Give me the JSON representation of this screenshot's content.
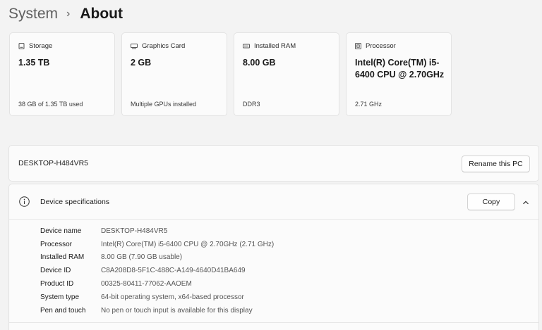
{
  "breadcrumb": {
    "parent": "System",
    "separator": "›",
    "current": "About"
  },
  "cards": [
    {
      "icon": "storage-icon",
      "label": "Storage",
      "value": "1.35 TB",
      "sub": "38 GB of 1.35 TB used"
    },
    {
      "icon": "graphics-card-icon",
      "label": "Graphics Card",
      "value": "2 GB",
      "sub": "Multiple GPUs installed"
    },
    {
      "icon": "ram-icon",
      "label": "Installed RAM",
      "value": "8.00 GB",
      "sub": "DDR3"
    },
    {
      "icon": "processor-icon",
      "label": "Processor",
      "value": "Intel(R) Core(TM) i5-6400 CPU @ 2.70GHz",
      "sub": "2.71 GHz"
    }
  ],
  "pc": {
    "name": "DESKTOP-H484VR5",
    "rename_label": "Rename this PC"
  },
  "specs": {
    "title": "Device specifications",
    "copy_label": "Copy",
    "rows": [
      {
        "key": "Device name",
        "value": "DESKTOP-H484VR5"
      },
      {
        "key": "Processor",
        "value": "Intel(R) Core(TM) i5-6400 CPU @ 2.70GHz (2.71 GHz)"
      },
      {
        "key": "Installed RAM",
        "value": "8.00 GB (7.90 GB usable)"
      },
      {
        "key": "Device ID",
        "value": "C8A208D8-5F1C-488C-A149-4640D41BA649"
      },
      {
        "key": "Product ID",
        "value": "00325-80411-77062-AAOEM"
      },
      {
        "key": "System type",
        "value": "64-bit operating system, x64-based processor"
      },
      {
        "key": "Pen and touch",
        "value": "No pen or touch input is available for this display"
      }
    ]
  },
  "colors": {
    "background": "#f3f3f3",
    "card": "#fbfbfb",
    "border": "#e3e3e3"
  }
}
